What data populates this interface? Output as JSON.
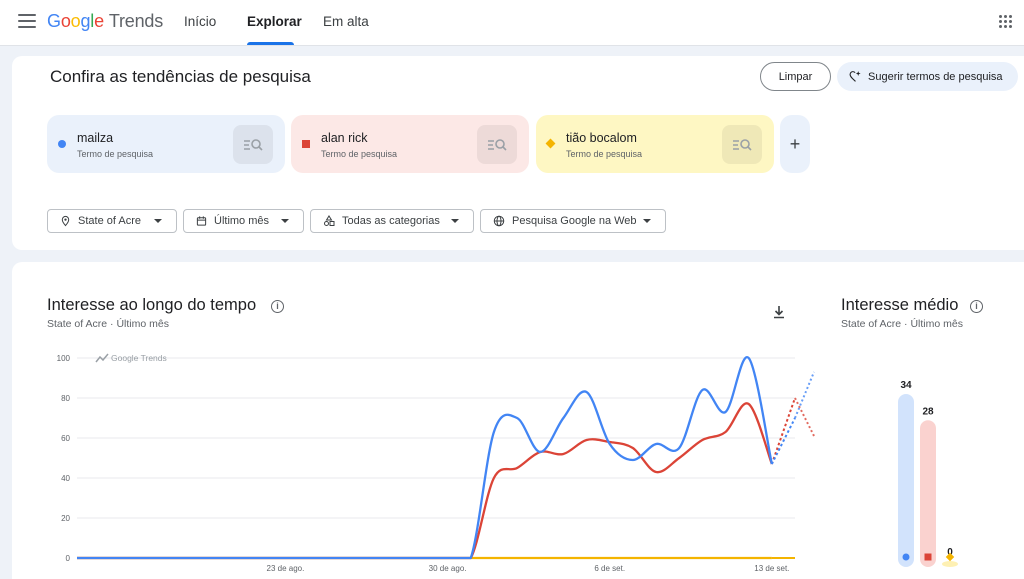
{
  "header": {
    "logo": {
      "g1": "G",
      "g2": "o",
      "g3": "o",
      "g4": "g",
      "g5": "l",
      "g6": "e",
      "trends": "Trends"
    },
    "nav": [
      {
        "label": "Início"
      },
      {
        "label": "Explorar"
      },
      {
        "label": "Em alta"
      }
    ],
    "active_tab": "Explorar",
    "icons": [
      "menu-icon",
      "apps-grid-icon"
    ]
  },
  "compare": {
    "title": "Confira as tendências de pesquisa",
    "clear_label": "Limpar",
    "suggest_label": "Sugerir termos de pesquisa",
    "terms": [
      {
        "name": "mailza",
        "type": "Termo de pesquisa",
        "color": "#4285f4",
        "bg": "#eaf1fb",
        "shape": "circle"
      },
      {
        "name": "alan rick",
        "type": "Termo de pesquisa",
        "color": "#db4437",
        "bg": "#fce8e6",
        "shape": "square"
      },
      {
        "name": "tião bocalom",
        "type": "Termo de pesquisa",
        "color": "#f4b400",
        "bg": "#fef7c3",
        "shape": "diamond"
      }
    ],
    "add_label": "+"
  },
  "filters": [
    {
      "label": "State of Acre",
      "icon": "location-pin-icon"
    },
    {
      "label": "Último mês",
      "icon": "calendar-icon"
    },
    {
      "label": "Todas as categorias",
      "icon": "categories-icon"
    },
    {
      "label": "Pesquisa Google na Web",
      "icon": "globe-icon"
    }
  ],
  "interest_over_time": {
    "title": "Interesse ao longo do tempo",
    "subtitle_location": "State of Acre",
    "subtitle_separator": "·",
    "subtitle_period": "Último mês",
    "watermark": "Google Trends"
  },
  "average_interest": {
    "title": "Interesse médio",
    "subtitle_location": "State of Acre",
    "subtitle_separator": "·",
    "subtitle_period": "Último mês"
  },
  "chart_data": [
    {
      "type": "line",
      "yticks": [
        0,
        20,
        40,
        60,
        80,
        100
      ],
      "ylim": [
        0,
        100
      ],
      "xlim": [
        "2024-08-14",
        "2024-09-14"
      ],
      "x_tick_labels": [
        {
          "date": "2024-08-23",
          "label": "23 de ago."
        },
        {
          "date": "2024-08-30",
          "label": "30 de ago."
        },
        {
          "date": "2024-09-06",
          "label": "6 de set."
        },
        {
          "date": "2024-09-13",
          "label": "13 de set."
        }
      ],
      "grid": true,
      "partial_data_from": "2024-09-13",
      "series": [
        {
          "key": "mailza",
          "color": "#4285f4",
          "x": [
            "2024-08-14",
            "2024-08-15",
            "2024-08-16",
            "2024-08-17",
            "2024-08-18",
            "2024-08-19",
            "2024-08-20",
            "2024-08-21",
            "2024-08-22",
            "2024-08-23",
            "2024-08-24",
            "2024-08-25",
            "2024-08-26",
            "2024-08-27",
            "2024-08-28",
            "2024-08-29",
            "2024-08-30",
            "2024-08-31",
            "2024-09-01",
            "2024-09-02",
            "2024-09-03",
            "2024-09-04",
            "2024-09-05",
            "2024-09-06",
            "2024-09-07",
            "2024-09-08",
            "2024-09-09",
            "2024-09-10",
            "2024-09-11",
            "2024-09-12",
            "2024-09-13",
            "2024-09-14"
          ],
          "values": [
            0,
            0,
            0,
            0,
            0,
            0,
            0,
            0,
            0,
            0,
            0,
            0,
            0,
            0,
            0,
            0,
            0,
            0,
            63,
            70,
            53,
            70,
            83,
            57,
            49,
            57,
            55,
            84,
            73,
            100,
            47,
            70
          ]
        },
        {
          "key": "alan rick",
          "color": "#db4437",
          "x": [
            "2024-08-14",
            "2024-08-15",
            "2024-08-16",
            "2024-08-17",
            "2024-08-18",
            "2024-08-19",
            "2024-08-20",
            "2024-08-21",
            "2024-08-22",
            "2024-08-23",
            "2024-08-24",
            "2024-08-25",
            "2024-08-26",
            "2024-08-27",
            "2024-08-28",
            "2024-08-29",
            "2024-08-30",
            "2024-08-31",
            "2024-09-01",
            "2024-09-02",
            "2024-09-03",
            "2024-09-04",
            "2024-09-05",
            "2024-09-06",
            "2024-09-07",
            "2024-09-08",
            "2024-09-09",
            "2024-09-10",
            "2024-09-11",
            "2024-09-12",
            "2024-09-13",
            "2024-09-14"
          ],
          "values": [
            0,
            0,
            0,
            0,
            0,
            0,
            0,
            0,
            0,
            0,
            0,
            0,
            0,
            0,
            0,
            0,
            0,
            0,
            40,
            45,
            53,
            52,
            59,
            58,
            55,
            43,
            50,
            59,
            63,
            77,
            47,
            80
          ]
        },
        {
          "key": "tião bocalom",
          "color": "#f4b400",
          "x": [
            "2024-08-14",
            "2024-08-15",
            "2024-08-16",
            "2024-08-17",
            "2024-08-18",
            "2024-08-19",
            "2024-08-20",
            "2024-08-21",
            "2024-08-22",
            "2024-08-23",
            "2024-08-24",
            "2024-08-25",
            "2024-08-26",
            "2024-08-27",
            "2024-08-28",
            "2024-08-29",
            "2024-08-30",
            "2024-08-31",
            "2024-09-01",
            "2024-09-02",
            "2024-09-03",
            "2024-09-04",
            "2024-09-05",
            "2024-09-06",
            "2024-09-07",
            "2024-09-08",
            "2024-09-09",
            "2024-09-10",
            "2024-09-11",
            "2024-09-12",
            "2024-09-13",
            "2024-09-14"
          ],
          "values": [
            0,
            0,
            0,
            0,
            0,
            0,
            0,
            0,
            0,
            0,
            0,
            0,
            0,
            0,
            0,
            0,
            0,
            0,
            0,
            0,
            0,
            0,
            0,
            0,
            0,
            0,
            0,
            0,
            0,
            0,
            0,
            0
          ]
        }
      ],
      "projection": [
        {
          "key": "mailza",
          "from": 70,
          "to": 93
        },
        {
          "key": "alan rick",
          "from": 80,
          "to": 61
        }
      ]
    },
    {
      "type": "bar",
      "categories": [
        "mailza",
        "alan rick",
        "tião bocalom"
      ],
      "values": [
        34,
        28,
        0
      ],
      "colors": [
        "#4285f4",
        "#db4437",
        "#f4b400"
      ],
      "track_colors": [
        "#d2e3fc",
        "#fad2cf",
        "#fef0b3"
      ],
      "ylim": [
        0,
        34
      ]
    }
  ]
}
